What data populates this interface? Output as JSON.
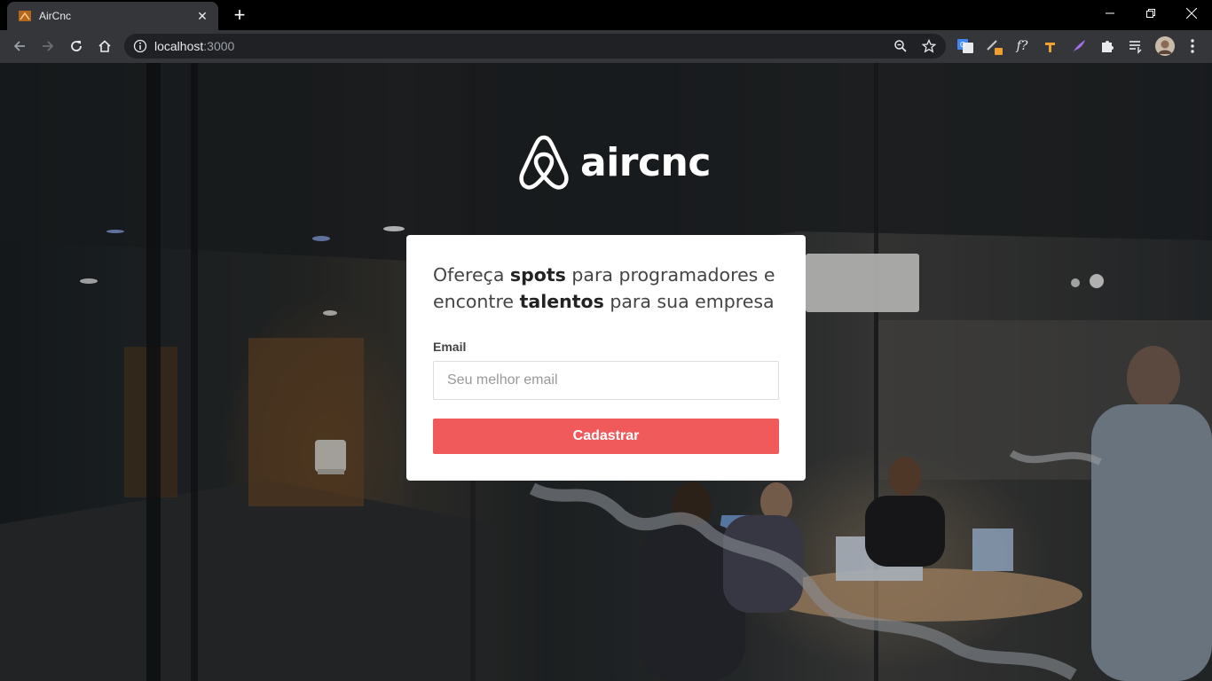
{
  "browser": {
    "tab_title": "AirCnc",
    "url_host": "localhost",
    "url_port": ":3000",
    "icons": [
      "back-icon",
      "forward-icon",
      "reload-icon",
      "home-icon",
      "site-info-icon",
      "zoom-icon",
      "bookmark-star-icon",
      "translate-icon",
      "extension-pencil-icon",
      "extension-function-icon",
      "extension-hammer-icon",
      "extension-feather-icon",
      "extensions-puzzle-icon",
      "reading-list-icon",
      "profile-avatar",
      "menu-icon"
    ]
  },
  "page": {
    "logo_text": "aircnc",
    "heading": {
      "part1": "Ofereça ",
      "bold1": "spots",
      "part2": " para programadores e encontre ",
      "bold2": "talentos",
      "part3": " para sua empresa"
    },
    "email_label": "Email",
    "email_placeholder": "Seu melhor email",
    "email_value": "",
    "submit_label": "Cadastrar"
  },
  "colors": {
    "accent": "#f05a5b",
    "card_background": "#ffffff",
    "chrome_toolbar": "#35363a"
  }
}
